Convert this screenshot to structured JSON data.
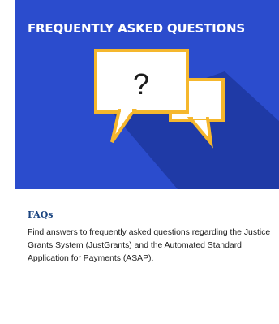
{
  "banner": {
    "title": "FREQUENTLY ASKED QUESTIONS",
    "icon_glyph": "?",
    "icon": "speech-bubbles-icon",
    "background_color": "#2b4ccd",
    "shadow_color": "#1f3aa6",
    "bubble_fill": "#ffffff",
    "bubble_border": "#f5b72d"
  },
  "card": {
    "link_title": "FAQs",
    "description": "Find answers to frequently asked questions regarding the Justice Grants System (JustGrants) and the Automated Standard Application for Payments (ASAP).",
    "link_color": "#1a4480"
  }
}
